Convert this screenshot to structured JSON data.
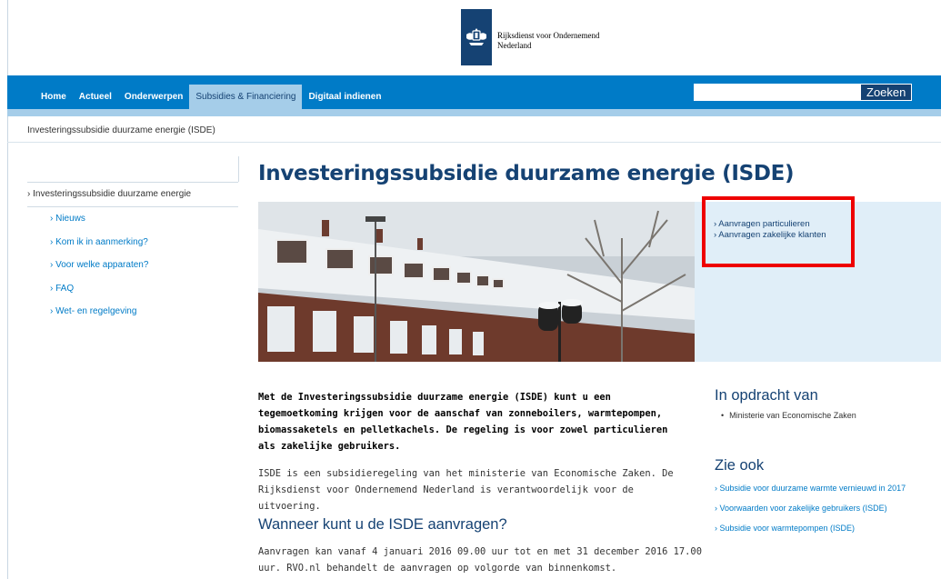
{
  "header": {
    "logo_line1": "Rijksdienst voor Ondernemend",
    "logo_line2": "Nederland"
  },
  "nav": {
    "items": [
      "Home",
      "Actueel",
      "Onderwerpen",
      "Subsidies & Financiering",
      "Digitaal indienen"
    ],
    "active_index": 3
  },
  "search": {
    "placeholder": "",
    "button_label": "Zoeken"
  },
  "breadcrumb": "Investeringssubsidie duurzame energie (ISDE)",
  "sidebar": {
    "current": "› Investeringssubsidie duurzame energie",
    "items": [
      "› Nieuws",
      "› Kom ik in aanmerking?",
      "› Voor welke apparaten?",
      "› FAQ",
      "› Wet- en regelgeving"
    ]
  },
  "page": {
    "title": "Investeringssubsidie duurzame energie (ISDE)",
    "quick_links": [
      "› Aanvragen particulieren",
      "› Aanvragen zakelijke klanten"
    ],
    "intro": "Met de Investeringssubsidie duurzame energie (ISDE) kunt u een tegemoetkoming krijgen voor de aanschaf van zonneboilers, warmtepompen, biomassaketels en pelletkachels. De regeling is voor zowel particulieren als zakelijke gebruikers.",
    "paragraph": "ISDE is een subsidieregeling van het ministerie van Economische Zaken. De Rijksdienst voor Ondernemend Nederland is verantwoordelijk voor de uitvoering.",
    "subheading": "Wanneer kunt u de ISDE aanvragen?",
    "paragraph2": "Aanvragen kan vanaf 4 januari 2016 09.00 uur tot en met 31 december 2016 17.00 uur. RVO.nl behandelt de aanvragen op volgorde van binnenkomst."
  },
  "aside": {
    "opdracht_heading": "In opdracht van",
    "opdracht_item": "Ministerie van Economische Zaken",
    "zie_ook_heading": "Zie ook",
    "zie_ook_links": [
      "› Subsidie voor duurzame warmte vernieuwd in 2017",
      "› Voorwaarden voor zakelijke gebruikers (ISDE)",
      "› Subsidie voor warmtepompen (ISDE)"
    ]
  },
  "colors": {
    "nav_blue": "#007bc7",
    "dark_blue": "#154273",
    "light_blue": "#a5cde9",
    "highlight_red": "#ee0000"
  }
}
